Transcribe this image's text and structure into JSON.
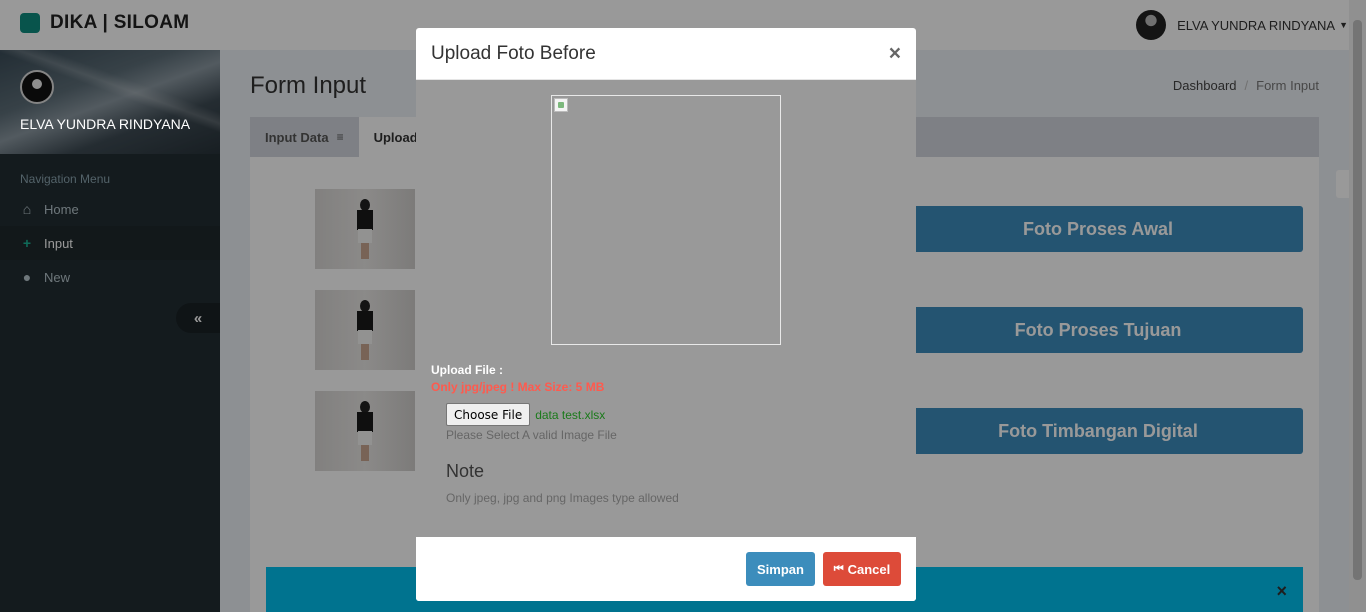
{
  "brand": {
    "title": "DIKA | SILOAM",
    "logo_icon": "square-logo"
  },
  "user": {
    "name": "ELVA YUNDRA RINDYANA",
    "caret_icon": "caret-down-icon"
  },
  "sidebar": {
    "username": "ELVA YUNDRA RINDYANA",
    "nav_header": "Navigation Menu",
    "items": [
      {
        "label": "Home",
        "icon": "home-icon",
        "glyph": "⌂",
        "active": false
      },
      {
        "label": "Input",
        "icon": "plus-icon",
        "glyph": "+",
        "active": true
      },
      {
        "label": "New",
        "icon": "user-icon",
        "glyph": "●",
        "active": false
      }
    ],
    "collapse_glyph": "«"
  },
  "page": {
    "title": "Form Input",
    "breadcrumb": {
      "home": "Dashboard",
      "separator": "/",
      "current": "Form Input"
    }
  },
  "tabs": [
    {
      "label": "Input Data",
      "icon": "database-icon",
      "glyph": "≡"
    },
    {
      "label": "Upload",
      "icon": "",
      "glyph": ""
    }
  ],
  "buttons": {
    "awal": "Foto Proses Awal",
    "tujuan": "Foto Proses Tujuan",
    "digital": "Foto Timbangan Digital"
  },
  "alert": {
    "close": "×"
  },
  "modal": {
    "title": "Upload Foto Before",
    "close": "×",
    "upload_label": "Upload File :",
    "upload_warning": "Only jpg/jpeg ! Max Size: 5 MB",
    "choose_file": "Choose File",
    "file_name": "data test.xlsx",
    "help_text": "Please Select A valid Image File",
    "note_title": "Note",
    "note_text": "Only jpeg, jpg and png Images type allowed",
    "save": "Simpan",
    "cancel": "Cancel",
    "cancel_glyph": "⏮"
  },
  "colors": {
    "primary": "#3c8dbc",
    "danger": "#dd4b39",
    "brand": "#0e8c7f",
    "sidebar": "#222d32",
    "warning_text": "#ff5a4e",
    "file_name_text": "#1a7a1a"
  }
}
